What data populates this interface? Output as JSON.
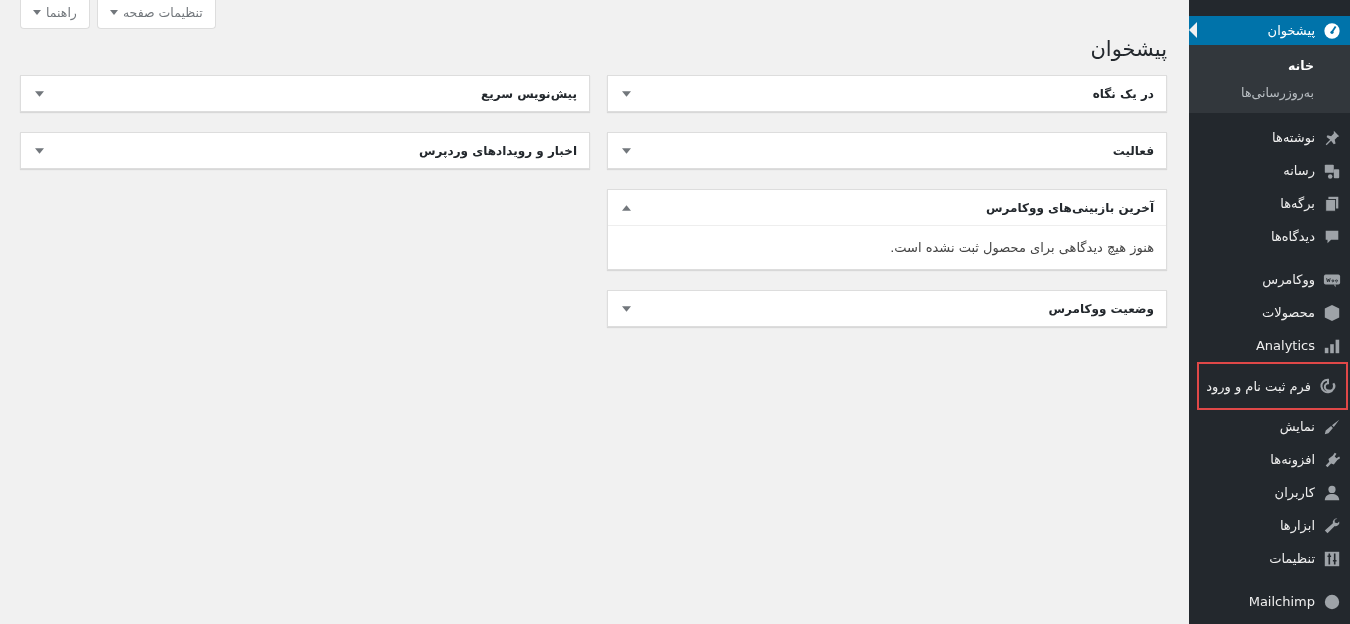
{
  "sidebar": {
    "groups": [
      {
        "items": [
          {
            "label": "پیشخوان",
            "kind": "gauge",
            "selected": true,
            "highlighted": false,
            "submenu": [
              {
                "label": "خانه",
                "selected": true
              },
              {
                "label": "به‌روزرسانی‌ها",
                "selected": false
              }
            ]
          }
        ]
      },
      {
        "items": [
          {
            "label": "نوشته‌ها",
            "kind": "pin",
            "selected": false,
            "highlighted": false
          },
          {
            "label": "رسانه",
            "kind": "media",
            "selected": false,
            "highlighted": false
          },
          {
            "label": "برگه‌ها",
            "kind": "pages",
            "selected": false,
            "highlighted": false
          },
          {
            "label": "دیدگاه‌ها",
            "kind": "comment",
            "selected": false,
            "highlighted": false
          }
        ]
      },
      {
        "items": [
          {
            "label": "ووکامرس",
            "kind": "woo",
            "selected": false,
            "highlighted": false
          },
          {
            "label": "محصولات",
            "kind": "box",
            "selected": false,
            "highlighted": false
          },
          {
            "label": "Analytics",
            "kind": "bars",
            "selected": false,
            "highlighted": false
          },
          {
            "label": "فرم ثبت نام و ورود",
            "kind": "swirl",
            "selected": false,
            "highlighted": true
          },
          {
            "label": "نمایش",
            "kind": "brush",
            "selected": false,
            "highlighted": false
          },
          {
            "label": "افزونه‌ها",
            "kind": "plug",
            "selected": false,
            "highlighted": false
          },
          {
            "label": "کاربران",
            "kind": "user",
            "selected": false,
            "highlighted": false
          },
          {
            "label": "ابزارها",
            "kind": "wrench",
            "selected": false,
            "highlighted": false
          },
          {
            "label": "تنظیمات",
            "kind": "sliders",
            "selected": false,
            "highlighted": false
          }
        ]
      },
      {
        "items": [
          {
            "label": "Mailchimp",
            "kind": "monkey",
            "selected": false,
            "highlighted": false
          }
        ]
      }
    ]
  },
  "screen_meta": [
    "تنظیمات صفحه",
    "راهنما"
  ],
  "page_title": "پیشخوان",
  "columns": [
    {
      "widgets": [
        {
          "title": "در یک نگاه",
          "expanded": false
        },
        {
          "title": "فعالیت",
          "expanded": false
        },
        {
          "title": "آخرین بازبینی‌های ووکامرس",
          "expanded": true,
          "body": "هنوز هیچ دیدگاهی برای محصول ثبت نشده است."
        },
        {
          "title": "وضعیت ووکامرس",
          "expanded": false
        }
      ]
    },
    {
      "widgets": [
        {
          "title": "پیش‌نویس سریع",
          "expanded": false
        },
        {
          "title": "اخبار و رویدادهای وردپرس",
          "expanded": false
        }
      ]
    }
  ]
}
